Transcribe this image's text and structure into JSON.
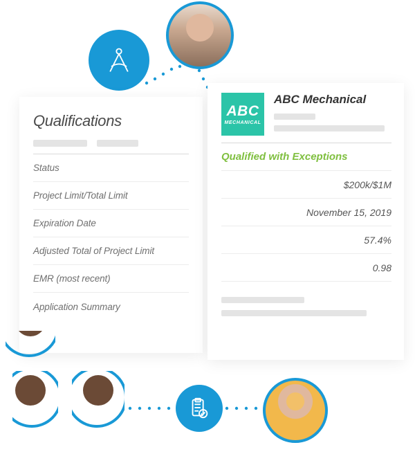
{
  "panel_left": {
    "title": "Qualifications",
    "fields": [
      "Status",
      "Project Limit/Total Limit",
      "Expiration Date",
      "Adjusted Total of Project Limit",
      "EMR (most recent)",
      "Application Summary"
    ]
  },
  "panel_right": {
    "company": {
      "logo_primary": "ABC",
      "logo_secondary": "MECHANICAL",
      "name": "ABC Mechanical"
    },
    "values": {
      "status": "Qualified with Exceptions",
      "project_limit": "$200k/$1M",
      "expiration": "November 15, 2019",
      "adjusted_pct": "57.4%",
      "emr": "0.98"
    }
  },
  "icons": {
    "compass": "compass-icon",
    "clipboard": "clipboard-check-icon"
  }
}
